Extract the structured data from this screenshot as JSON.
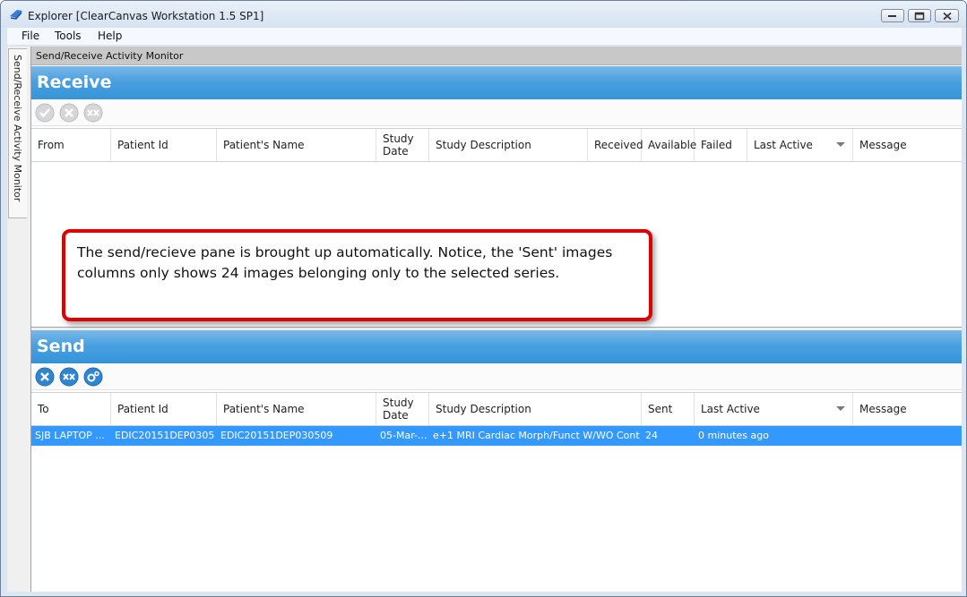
{
  "window": {
    "title": "Explorer [ClearCanvas Workstation 1.5 SP1]"
  },
  "menu": [
    "File",
    "Tools",
    "Help"
  ],
  "side_tab": {
    "label": "Send/Receive Activity Monitor"
  },
  "content_header": "Send/Receive Activity Monitor",
  "receive": {
    "title": "Receive",
    "toolbar": [
      "check-icon",
      "cancel-icon",
      "cancel-all-icon"
    ],
    "columns": [
      "From",
      "Patient Id",
      "Patient's Name",
      "Study Date",
      "Study Description",
      "Received",
      "Available",
      "Failed",
      "Last Active",
      "Message"
    ],
    "rows": []
  },
  "send": {
    "title": "Send",
    "toolbar": [
      "cancel-icon",
      "cancel-all-icon",
      "settings-icon"
    ],
    "columns": [
      "To",
      "Patient Id",
      "Patient's Name",
      "Study Date",
      "Study Description",
      "Sent",
      "Last Active",
      "Message"
    ],
    "rows": [
      {
        "to": "SJB LAPTOP ...",
        "patient_id": "EDIC20151DEP0305...",
        "patient_name": "EDIC20151DEP030509",
        "study_date": "05-Mar-...",
        "study_description": "e+1 MRI Cardiac Morph/Funct W/WO Cont",
        "sent": "24",
        "last_active": "0 minutes ago",
        "message": ""
      }
    ]
  },
  "callout": {
    "text": "The send/recieve pane is brought up automatically.  Notice, the 'Sent' images columns only shows 24 images belonging only to the selected series."
  },
  "colors": {
    "section_blue": "#3494d8",
    "selection_blue": "#3399ff",
    "callout_border": "#e00000"
  }
}
